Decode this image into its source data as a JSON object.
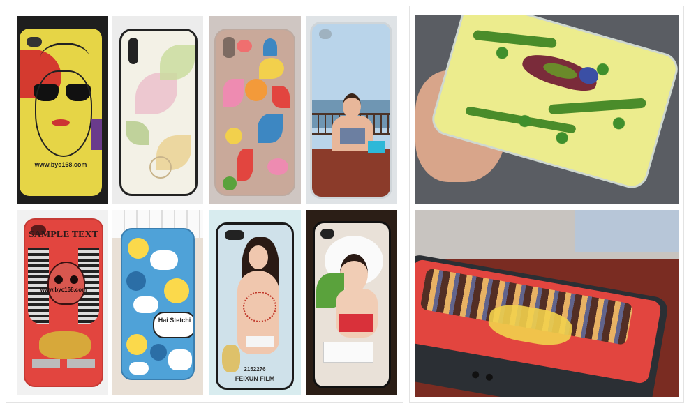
{
  "tiles": {
    "tile1_caption": "www.byc168.com",
    "tile2_caption": "",
    "tile3_caption": "",
    "tile5_top_text": "SAMPLE TEXT",
    "tile5_caption": "www.byc168.com",
    "tile6_bubble_1": "Hai Stetchi",
    "tile7_caption": "FEIXUN FILM",
    "tile7_code": "2152276"
  },
  "colors": {
    "yellow": "#e7d94a",
    "red": "#d9313a",
    "dark_bg": "#2a2a2a",
    "sky": "#b9d4ea",
    "sea": "#6f96b3",
    "skin": "#e8b79a",
    "leaf_green": "#5aa23c",
    "skull_red": "#e2453f",
    "blue_cartoon": "#4fa2d8"
  }
}
